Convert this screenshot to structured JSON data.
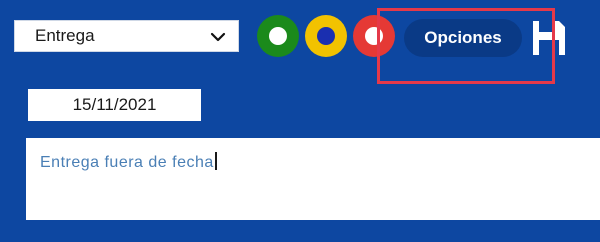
{
  "dropdown": {
    "selected": "Entrega"
  },
  "status_buttons": [
    {
      "name": "green",
      "ring": "#1b8a1b",
      "dot": "#ffffff"
    },
    {
      "name": "yellow",
      "ring": "#f2c200",
      "dot": "#1a2fb0"
    },
    {
      "name": "red",
      "ring": "#e53935",
      "dot": "#ffffff"
    }
  ],
  "options_button": {
    "label": "Opciones"
  },
  "date_field": {
    "value": "15/11/2021"
  },
  "comment": {
    "value": "Entrega fuera de fecha"
  },
  "colors": {
    "panel_bg": "#0d47a1",
    "highlight": "#e53949",
    "button_bg": "#0a3a86"
  },
  "icons": {
    "dropdown": "chevron-down-icon",
    "save": "save-icon"
  }
}
